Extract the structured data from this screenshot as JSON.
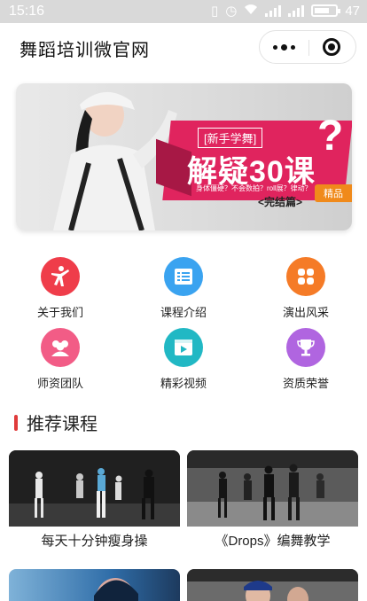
{
  "status_bar": {
    "time": "15:16",
    "battery": "47"
  },
  "nav": {
    "title": "舞蹈培训微官网"
  },
  "banner": {
    "headline": "[新手学舞]",
    "big": "解疑30课",
    "subtitle": "身体僵硬？不会数拍？roll展？律动？",
    "ending": "<完结篇>",
    "tag": "精品"
  },
  "menu": [
    {
      "label": "关于我们",
      "icon": "dancer-icon",
      "color": "#ef3d4a"
    },
    {
      "label": "课程介绍",
      "icon": "list-icon",
      "color": "#3aa3f0"
    },
    {
      "label": "演出风采",
      "icon": "flower-icon",
      "color": "#f57b27"
    },
    {
      "label": "师资团队",
      "icon": "team-icon",
      "color": "#f25c86"
    },
    {
      "label": "精彩视频",
      "icon": "video-icon",
      "color": "#21b8c4"
    },
    {
      "label": "资质荣誉",
      "icon": "trophy-icon",
      "color": "#b065e0"
    }
  ],
  "section": {
    "title": "推荐课程"
  },
  "courses": [
    {
      "name": "每天十分钟瘦身操"
    },
    {
      "name": "《Drops》编舞教学"
    }
  ]
}
